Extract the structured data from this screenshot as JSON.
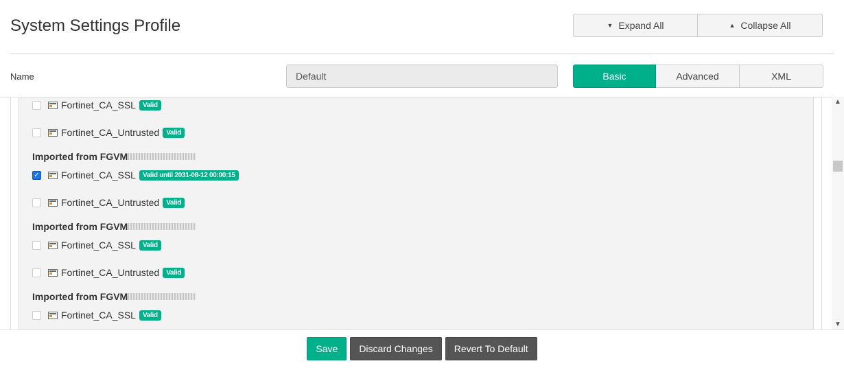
{
  "header": {
    "title": "System Settings Profile",
    "expand_all": "Expand All",
    "collapse_all": "Collapse All"
  },
  "name": {
    "label": "Name",
    "value": "Default"
  },
  "tabs": [
    {
      "label": "Basic",
      "active": true
    },
    {
      "label": "Advanced"
    },
    {
      "label": "XML"
    }
  ],
  "items": {
    "i0": {
      "name": "Fortinet_CA_SSL",
      "badge": "Valid"
    },
    "i1": {
      "name": "Fortinet_CA_Untrusted",
      "badge": "Valid"
    },
    "h1": "Imported from FGVM",
    "i2": {
      "name": "Fortinet_CA_SSL",
      "badge": "Valid until 2031-08-12 00:00:15",
      "checked": true
    },
    "i3": {
      "name": "Fortinet_CA_Untrusted",
      "badge": "Valid"
    },
    "h2": "Imported from FGVM",
    "i4": {
      "name": "Fortinet_CA_SSL",
      "badge": "Valid"
    },
    "i5": {
      "name": "Fortinet_CA_Untrusted",
      "badge": "Valid"
    },
    "h3": "Imported from FGVM",
    "i6": {
      "name": "Fortinet_CA_SSL",
      "badge": "Valid"
    }
  },
  "footer": {
    "save": "Save",
    "discard": "Discard Changes",
    "revert": "Revert To Default"
  },
  "colors": {
    "accent": "#00b08a",
    "dark_button": "#555555"
  }
}
